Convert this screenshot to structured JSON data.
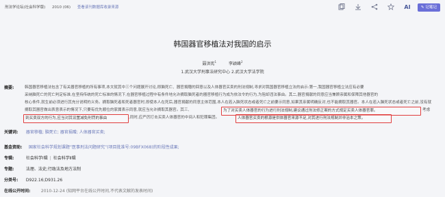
{
  "breadcrumb": {
    "source": "刑法学论坛(社会科学版)",
    "issue": "2010 (06)",
    "history_link": "查看该刊数据库收录来源"
  },
  "toolbar": {
    "icons": [
      "copy-icon",
      "download-icon",
      "share-icon",
      "star-icon",
      "ai-icon"
    ],
    "ai_label": "AI",
    "note_button": "记笔记"
  },
  "article": {
    "title": "韩国器官移植法对我国的启示",
    "authors": [
      {
        "name": "聂洪宪",
        "sup": "1"
      },
      {
        "name": "李颖峰",
        "sup": "2"
      }
    ],
    "affiliations": "1.武汉大学刑事法研究中心  2.武汉大学法学院"
  },
  "abstract": {
    "label": "摘要:",
    "lines": [
      "韩国器官移植法包含了有关器官移植的所有事项,本文就其中三个问题展开讨论,即脑死亡、器官捐赠的回意以及人体器官买卖的刑法规制,寻求对我国器官移植立法的启示:第一,我国器官移植立法应有必要",
      "采纳脑死亡的死亡判定标准,在坚持传统的死亡标准的情况下,在器官移植过程中有条件地允许摘取脑死者的器官移植行为成为依法令的行为,为阻却违法事由。其二,器官捐献的同意应当兼顾亲属和保障其他器官的",
      "核心条件,就生前必须进行其充分说明的义务。摘取脑死者和死者器官时,即使本人在死后,器官捐献的同意主体范围,本人在若入脑死状态或者死亡之前要示同意,如果其亲属明确反对,也不能摘取其器官。本人在若入脑死状态或者死亡之前,没有就",
      "摘取其器官做出表意表示的情况下,只要有优先顺位的家属表示同意,就应当允许摘取其器官。其三,"
    ],
    "hl1_text": "为了对买卖人体器官的行为进行刑法规制,建议通过刑法修正案的方式规定买卖人体器官罪。",
    "hl1_after": "考虑",
    "hl2_text": "到买卖双方的行为,应当对其设置减免刑罚的事由",
    "hl2_after": ",同时,应严厉打击买卖人体器官的中间人和犯罪集团。",
    "hl3_text": "人体器官买卖的根源是供体器官来源不足,对其进行刑法规制并非治本之策。"
  },
  "keywords": {
    "label": "关键词:",
    "items": [
      "器官移植;",
      "脑死亡;",
      "器官捐赠;",
      "人体器官买卖;"
    ]
  },
  "fund": {
    "label": "基金资助:",
    "text": "国家社会科学规划课题“医事刑法问题研究”(项目批准号:09BFX068)的阶段性成果;"
  },
  "subject": {
    "label": "专辑:",
    "items": [
      "社会科学Ⅰ辑",
      "社会科学Ⅱ辑"
    ]
  },
  "topic": {
    "label": "专题:",
    "text": "法理、法史;行政法及地方法制"
  },
  "classification": {
    "label": "分类号:",
    "text": "D922.16;D931.26"
  },
  "publish_date": {
    "label": "在线公开时间:",
    "text": "2010-12-24  (知网平台在线公开时间,不代表文献的发表时间)"
  }
}
